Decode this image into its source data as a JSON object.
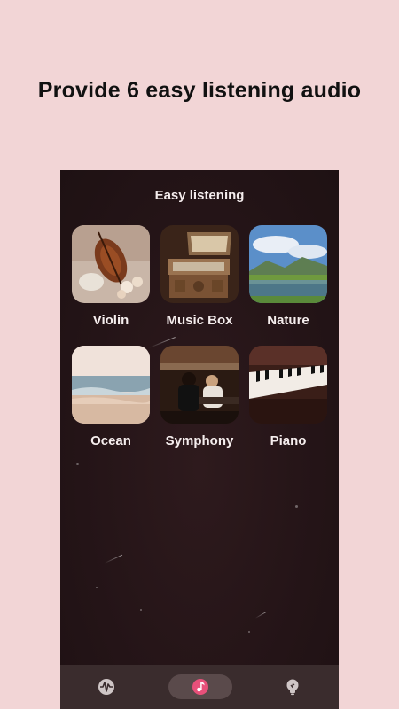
{
  "headline": "Provide 6 easy listening audio",
  "screen": {
    "title": "Easy listening",
    "items": [
      {
        "label": "Violin"
      },
      {
        "label": "Music Box"
      },
      {
        "label": "Nature"
      },
      {
        "label": "Ocean"
      },
      {
        "label": "Symphony"
      },
      {
        "label": "Piano"
      }
    ]
  },
  "nav": {
    "items": [
      {
        "icon": "waveform-icon",
        "active": false
      },
      {
        "icon": "music-note-icon",
        "active": true
      },
      {
        "icon": "lightbulb-icon",
        "active": false
      }
    ]
  },
  "colors": {
    "background": "#f2d5d6",
    "screen_bg": "#241417",
    "navbar_bg": "#3a2c2d",
    "accent": "#e8507a"
  }
}
